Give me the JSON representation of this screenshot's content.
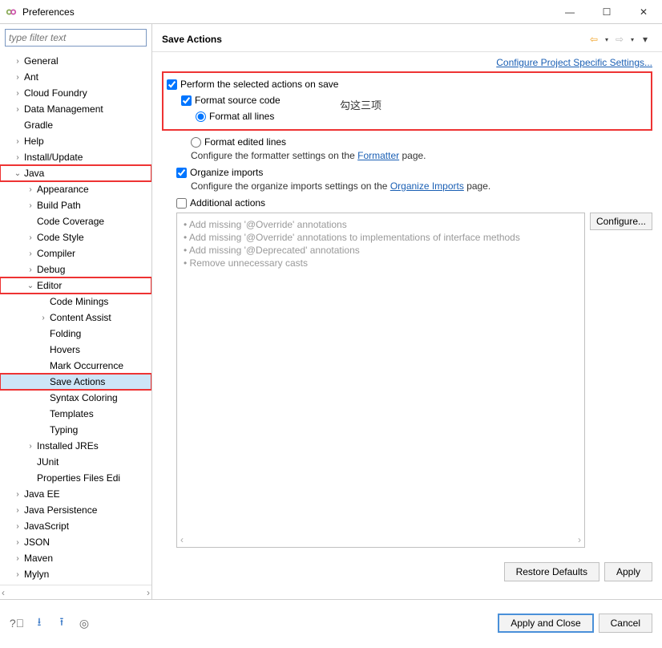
{
  "title": "Preferences",
  "filter_placeholder": "type filter text",
  "tree": {
    "general": "General",
    "ant": "Ant",
    "cloud": "Cloud Foundry",
    "datamgmt": "Data Management",
    "gradle": "Gradle",
    "help": "Help",
    "install": "Install/Update",
    "java": "Java",
    "appearance": "Appearance",
    "buildpath": "Build Path",
    "codecov": "Code Coverage",
    "codestyle": "Code Style",
    "compiler": "Compiler",
    "debug": "Debug",
    "editor": "Editor",
    "codeminings": "Code Minings",
    "contentassist": "Content Assist",
    "folding": "Folding",
    "hovers": "Hovers",
    "markocc": "Mark Occurrence",
    "saveactions": "Save Actions",
    "syntaxcolor": "Syntax Coloring",
    "templates": "Templates",
    "typing": "Typing",
    "installedjres": "Installed JREs",
    "junit": "JUnit",
    "propfiles": "Properties Files Edi",
    "javaee": "Java EE",
    "javapersist": "Java Persistence",
    "javascript": "JavaScript",
    "json": "JSON",
    "maven": "Maven",
    "mylyn": "Mylyn"
  },
  "page": {
    "heading": "Save Actions",
    "link": "Configure Project Specific Settings...",
    "chk_perform": "Perform the selected actions on save",
    "chk_format": "Format source code",
    "rad_all": "Format all lines",
    "rad_edited": "Format edited lines",
    "annot": "勾这三项",
    "fmt_cfg_pre": "Configure the formatter settings on the ",
    "fmt_cfg_link": "Formatter",
    "fmt_cfg_post": " page.",
    "chk_organize": "Organize imports",
    "org_cfg_pre": "Configure the organize imports settings on the ",
    "org_cfg_link": "Organize Imports",
    "org_cfg_post": " page.",
    "chk_addl": "Additional actions",
    "addl1": "Add missing '@Override' annotations",
    "addl2": "Add missing '@Override' annotations to implementations of interface methods",
    "addl3": "Add missing '@Deprecated' annotations",
    "addl4": "Remove unnecessary casts",
    "configure_btn": "Configure...",
    "restore": "Restore Defaults",
    "apply": "Apply",
    "apply_close": "Apply and Close",
    "cancel": "Cancel"
  }
}
